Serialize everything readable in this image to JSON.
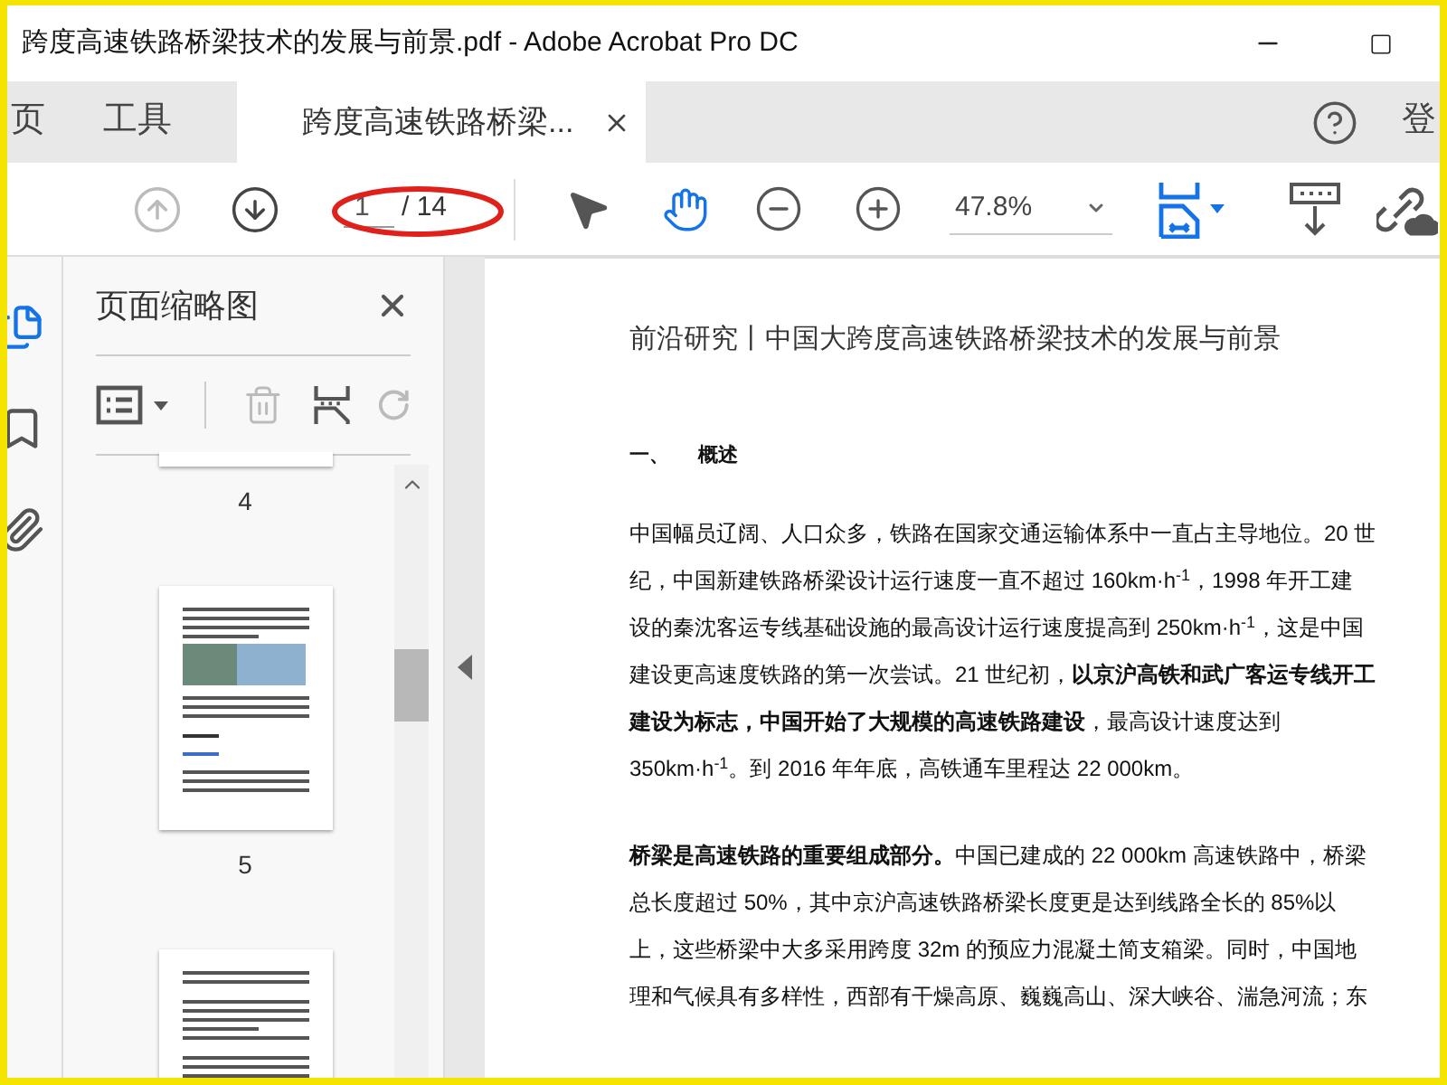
{
  "window": {
    "title": "跨度高速铁路桥梁技术的发展与前景.pdf - Adobe Acrobat Pro DC"
  },
  "tabs": [
    {
      "label": "页",
      "kind": "nav",
      "selected": false
    },
    {
      "label": "工具",
      "kind": "nav",
      "selected": false
    },
    {
      "label": "跨度高速铁路桥梁...",
      "kind": "document",
      "selected": true
    }
  ],
  "account_label": "登",
  "toolbar": {
    "previous_page": {
      "disabled": true
    },
    "next_page": {
      "disabled": false
    },
    "page_number": "1",
    "page_total": "/ 14",
    "zoom": "47.8%",
    "tools": [
      {
        "kind": "select",
        "selected": false
      },
      {
        "kind": "hand",
        "selected": true
      }
    ]
  },
  "sidebar": {
    "rail": [
      {
        "kind": "thumbnails",
        "selected": true
      },
      {
        "kind": "bookmarks",
        "selected": false
      },
      {
        "kind": "attachments",
        "selected": false
      }
    ],
    "panel_title": "页面缩略图",
    "delete": {
      "disabled": true
    },
    "rotate": {
      "disabled": true
    },
    "thumbnails": [
      {
        "kind": "partial",
        "label": "4"
      },
      {
        "kind": "figure",
        "label": "5"
      },
      {
        "kind": "text"
      }
    ]
  },
  "document": {
    "title": "前沿研究丨中国大跨度高速铁路桥梁技术的发展与前景",
    "heading_number": "一、",
    "heading": "概述",
    "paragraphs": [
      {
        "lines": [
          "中国幅员辽阔、人口众多，铁路在国家交通运输体系中一直占主导地位。20 世",
          "纪，中国新建铁路桥梁设计运行速度一直不超过 160km·h$^{-1}$，1998 年开工建",
          "设的秦沈客运专线基础设施的最高设计运行速度提高到 250km·h$^{-1}$，这是中国",
          "建设更高速度铁路的第一次尝试。21 世纪初，**以京沪高铁和武广客运专线开工**",
          "**建设为标志，中国开始了大规模的高速铁路建设**，最高设计速度达到",
          "350km·h$^{-1}$。到 2016 年年底，高铁通车里程达 22 000km。"
        ]
      },
      {
        "lines": [
          "**桥梁是高速铁路的重要组成部分。**中国已建成的 22 000km 高速铁路中，桥梁",
          "总长度超过 50%，其中京沪高速铁路桥梁长度更是达到线路全长的 85%以",
          "上，这些桥梁中大多采用跨度 32m 的预应力混凝土简支箱梁。同时，中国地",
          "理和气候具有多样性，西部有干燥高原、巍巍高山、深大峡谷、湍急河流；东"
        ]
      }
    ]
  }
}
